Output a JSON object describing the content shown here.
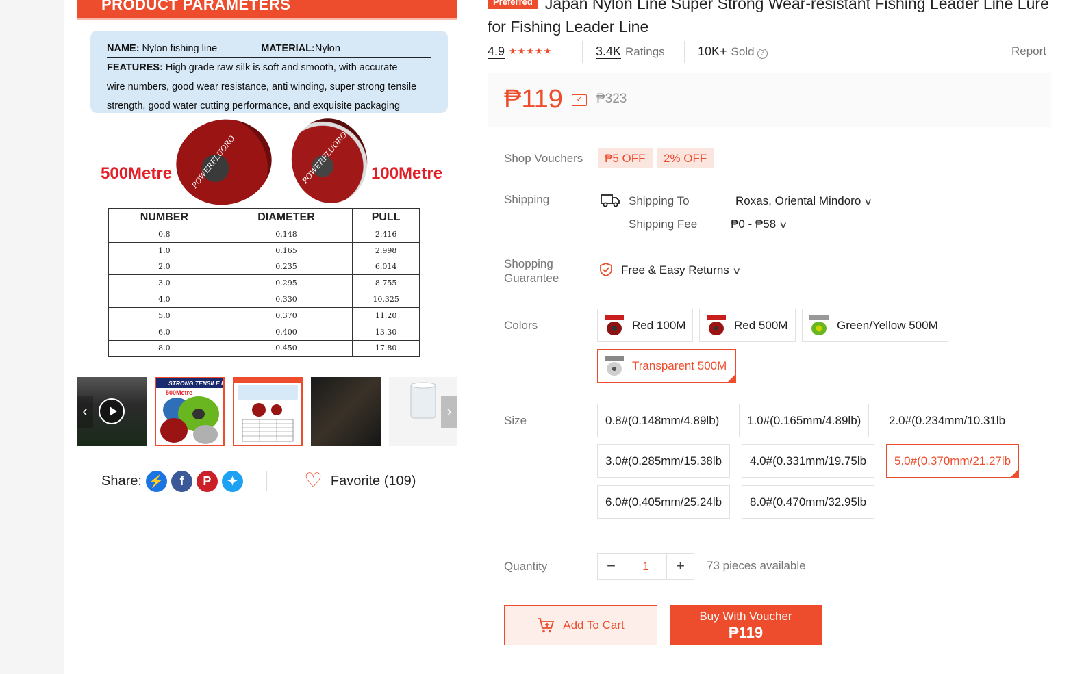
{
  "gallery": {
    "banner_title": "PRODUCT PARAMETERS",
    "specs": {
      "name_label": "NAME:",
      "name_value": " Nylon fishing line",
      "material_label": "MATERIAL:",
      "material_value": "Nylon",
      "features_label": "FEATURES:",
      "features_line1": " High grade raw silk is soft and smooth, with accurate",
      "features_line2": "wire numbers, good wear resistance, anti winding, super strong tensile",
      "features_line3": "strength, good water cutting performance, and exquisite packaging"
    },
    "spool_big_label": "POWERFLUORO",
    "spool_small_label": "POWERFLUORO",
    "metre_left": "500Metre",
    "metre_right": "100Metre",
    "table": {
      "headers": [
        "NUMBER",
        "DIAMETER",
        "PULL"
      ],
      "rows": [
        [
          "0.8",
          "0.148",
          "2.416"
        ],
        [
          "1.0",
          "0.165",
          "2.998"
        ],
        [
          "2.0",
          "0.235",
          "6.014"
        ],
        [
          "3.0",
          "0.295",
          "8.755"
        ],
        [
          "4.0",
          "0.330",
          "10.325"
        ],
        [
          "5.0",
          "0.370",
          "11.20"
        ],
        [
          "6.0",
          "0.400",
          "13.30"
        ],
        [
          "8.0",
          "0.450",
          "17.80"
        ]
      ]
    },
    "thumb2_caption": "STRONG TENSILE FORCE",
    "thumb2_sub": "500Metre"
  },
  "share": {
    "label": "Share:",
    "favorite_label": "Favorite (109)"
  },
  "product": {
    "badge": "Preferred",
    "title": "Japan Nylon Line Super Strong Wear-resistant Fishing Leader Line Lure for Fishing Leader Line",
    "rating": "4.9",
    "stars": "★★★★★",
    "ratings_count": "3.4K",
    "ratings_label": "Ratings",
    "sold_count": "10K+",
    "sold_label": "Sold",
    "report_label": "Report",
    "price": "₱119",
    "price_original": "₱323"
  },
  "vouchers": {
    "label": "Shop Vouchers",
    "items": [
      "₱5 OFF",
      "2% OFF"
    ]
  },
  "shipping": {
    "label": "Shipping",
    "to_label": "Shipping To",
    "to_value": "Roxas, Oriental Mindoro",
    "fee_label": "Shipping Fee",
    "fee_value": "₱0 - ₱58"
  },
  "guarantee": {
    "label_line1": "Shopping",
    "label_line2": "Guarantee",
    "value": "Free & Easy Returns"
  },
  "colors": {
    "label": "Colors",
    "options": [
      "Red 100M",
      "Red 500M",
      "Green/Yellow 500M",
      "Transparent 500M"
    ],
    "selected": "Transparent 500M"
  },
  "size": {
    "label": "Size",
    "options": [
      "0.8#(0.148mm/4.89lb)",
      "1.0#(0.165mm/4.89lb)",
      "2.0#(0.234mm/10.31lb",
      "3.0#(0.285mm/15.38lb",
      "4.0#(0.331mm/19.75lb",
      "5.0#(0.370mm/21.27lb",
      "6.0#(0.405mm/25.24lb",
      "8.0#(0.470mm/32.95lb"
    ],
    "selected": "5.0#(0.370mm/21.27lb"
  },
  "quantity": {
    "label": "Quantity",
    "minus": "−",
    "value": "1",
    "plus": "+",
    "available": "73 pieces available"
  },
  "actions": {
    "add_to_cart": "Add To Cart",
    "buy_line1": "Buy With Voucher",
    "buy_line2": "₱119"
  },
  "colors_accent": {
    "brand": "#ee4d2d",
    "voucher_bg": "#fbe5df"
  }
}
